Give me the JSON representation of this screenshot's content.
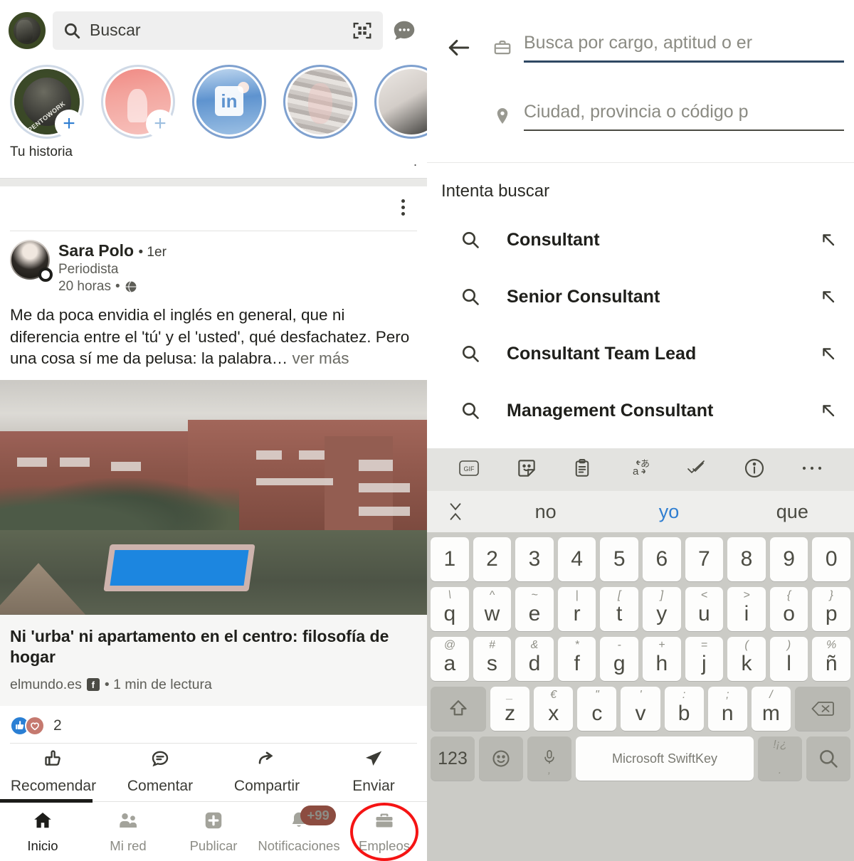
{
  "left": {
    "search": {
      "placeholder": "Buscar",
      "icon": "search-icon",
      "qr_icon": "qr-scan-icon",
      "messaging_icon": "messaging-icon"
    },
    "stories": {
      "your_story_label": "Tu historia",
      "items": [
        {
          "name": "your-story",
          "frame": "#OPENTOWORK",
          "has_plus": true
        },
        {
          "name": "story-2",
          "has_plus": true
        },
        {
          "name": "story-3-linkedin",
          "mark": "in"
        },
        {
          "name": "story-4"
        },
        {
          "name": "story-5"
        }
      ]
    },
    "post": {
      "author": "Sara Polo",
      "degree": "• 1er",
      "headline": "Periodista",
      "time": "20 horas",
      "visibility_icon": "globe-icon",
      "menu_icon": "kebab-menu-icon",
      "text": "Me da poca envidia el inglés en general, que ni diferencia entre el 'tú' y el 'usted', qué desfachatez. Pero una cosa sí me da pelusa: la palabra…",
      "see_more": " ver más",
      "article": {
        "title": "Ni 'urba' ni apartamento en el centro: filosofía de hogar",
        "source": "elmundo.es",
        "source_badge": "f",
        "read_time": "• 1 min de lectura"
      },
      "reactions": {
        "count": "2",
        "types": [
          "like-icon",
          "love-icon"
        ]
      },
      "actions": [
        {
          "label": "Recomendar",
          "icon": "thumbs-up-icon"
        },
        {
          "label": "Comentar",
          "icon": "comment-icon"
        },
        {
          "label": "Compartir",
          "icon": "share-icon"
        },
        {
          "label": "Enviar",
          "icon": "send-icon"
        }
      ]
    },
    "bottom_nav": [
      {
        "label": "Inicio",
        "icon": "home-icon",
        "active": true
      },
      {
        "label": "Mi red",
        "icon": "network-icon",
        "active": false
      },
      {
        "label": "Publicar",
        "icon": "post-plus-icon",
        "active": false
      },
      {
        "label": "Notificaciones",
        "icon": "bell-icon",
        "badge": "+99",
        "active": false
      },
      {
        "label": "Empleos",
        "icon": "briefcase-icon",
        "active": false,
        "highlighted": true
      }
    ]
  },
  "right": {
    "back_icon": "back-arrow-icon",
    "keyword_field": {
      "icon": "briefcase-icon",
      "placeholder": "Busca por cargo, aptitud o er"
    },
    "location_field": {
      "icon": "location-pin-icon",
      "placeholder": "Ciudad, provincia o código p"
    },
    "try_search_label": "Intenta buscar",
    "suggestions": [
      {
        "text": "Consultant",
        "icon": "search-icon",
        "fill_icon": "arrow-up-left-icon"
      },
      {
        "text": "Senior Consultant",
        "icon": "search-icon",
        "fill_icon": "arrow-up-left-icon"
      },
      {
        "text": "Consultant Team Lead",
        "icon": "search-icon",
        "fill_icon": "arrow-up-left-icon"
      },
      {
        "text": "Management Consultant",
        "icon": "search-icon",
        "fill_icon": "arrow-up-left-icon"
      }
    ],
    "keyboard": {
      "toolbar": [
        "gif-icon",
        "sticker-icon",
        "clipboard-icon",
        "translate-icon",
        "editor-check-icon",
        "info-icon",
        "more-icon"
      ],
      "predictions": [
        {
          "text": "no",
          "highlighted": false
        },
        {
          "text": "yo",
          "highlighted": true
        },
        {
          "text": "que",
          "highlighted": false
        }
      ],
      "collapse_icon": "collapse-icon",
      "number_row": [
        "1",
        "2",
        "3",
        "4",
        "5",
        "6",
        "7",
        "8",
        "9",
        "0"
      ],
      "row1": [
        {
          "key": "q",
          "alt": "\\"
        },
        {
          "key": "w",
          "alt": "^"
        },
        {
          "key": "e",
          "alt": "~"
        },
        {
          "key": "r",
          "alt": "|"
        },
        {
          "key": "t",
          "alt": "["
        },
        {
          "key": "y",
          "alt": "]"
        },
        {
          "key": "u",
          "alt": "<"
        },
        {
          "key": "i",
          "alt": ">"
        },
        {
          "key": "o",
          "alt": "{"
        },
        {
          "key": "p",
          "alt": "}"
        }
      ],
      "row2": [
        {
          "key": "a",
          "alt": "@"
        },
        {
          "key": "s",
          "alt": "#"
        },
        {
          "key": "d",
          "alt": "&"
        },
        {
          "key": "f",
          "alt": "*"
        },
        {
          "key": "g",
          "alt": "-"
        },
        {
          "key": "h",
          "alt": "+"
        },
        {
          "key": "j",
          "alt": "="
        },
        {
          "key": "k",
          "alt": "("
        },
        {
          "key": "l",
          "alt": ")"
        },
        {
          "key": "ñ",
          "alt": "%"
        }
      ],
      "row3": [
        {
          "key": "z",
          "alt": "_"
        },
        {
          "key": "x",
          "alt": "€"
        },
        {
          "key": "c",
          "alt": "\""
        },
        {
          "key": "v",
          "alt": "'"
        },
        {
          "key": "b",
          "alt": ":"
        },
        {
          "key": "n",
          "alt": ";"
        },
        {
          "key": "m",
          "alt": "/"
        }
      ],
      "shift_icon": "shift-icon",
      "backspace_icon": "backspace-icon",
      "numeric_key": "123",
      "emoji_icon": "emoji-icon",
      "mic_icon": "mic-icon",
      "comma_key": ",",
      "space_label": "Microsoft SwiftKey",
      "punct_alt": "!¡¿",
      "period_key": ".",
      "search_icon": "search-icon"
    }
  },
  "colors": {
    "accent_blue": "#2f7ed1",
    "highlight_red": "#f51414",
    "badge_red": "#8c4c40",
    "field_underline": "#2f4863"
  }
}
